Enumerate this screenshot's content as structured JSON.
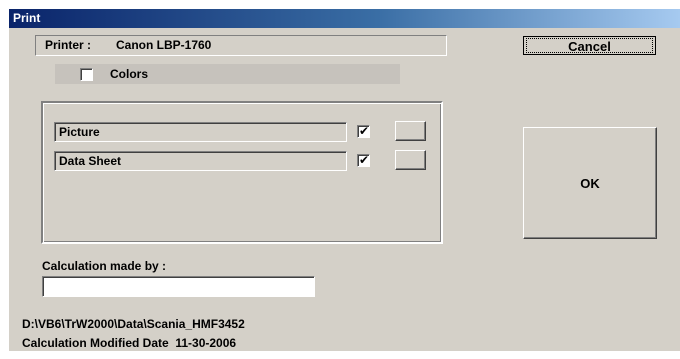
{
  "window": {
    "title": "Print"
  },
  "printer": {
    "label": "Printer :",
    "name": "Canon LBP-1760"
  },
  "colors": {
    "label": "Colors",
    "checked": false
  },
  "items": [
    {
      "label": "Picture",
      "checked": true
    },
    {
      "label": "Data Sheet",
      "checked": true
    }
  ],
  "buttons": {
    "cancel": "Cancel",
    "ok": "OK"
  },
  "calculation": {
    "label": "Calculation made by :",
    "value": ""
  },
  "footer": {
    "path": "D:\\VB6\\TrW2000\\Data\\Scania_HMF3452",
    "modified_label": "Calculation Modified Date",
    "modified_date": "11-30-2006"
  },
  "check_mark": "✔"
}
